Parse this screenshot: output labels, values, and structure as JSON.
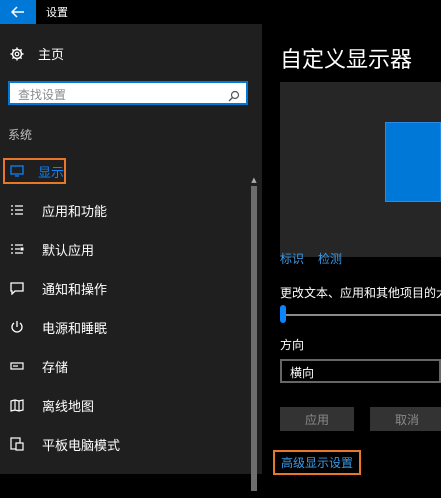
{
  "window": {
    "title": "设置"
  },
  "sidebar": {
    "home_label": "主页",
    "search_placeholder": "查找设置",
    "section_label": "系统",
    "items": [
      {
        "label": "显示",
        "icon": "monitor-icon",
        "active": true
      },
      {
        "label": "应用和功能",
        "icon": "list-icon"
      },
      {
        "label": "默认应用",
        "icon": "default-apps-icon"
      },
      {
        "label": "通知和操作",
        "icon": "notification-icon"
      },
      {
        "label": "电源和睡眠",
        "icon": "power-icon"
      },
      {
        "label": "存储",
        "icon": "storage-icon"
      },
      {
        "label": "离线地图",
        "icon": "map-icon"
      },
      {
        "label": "平板电脑模式",
        "icon": "tablet-mode-icon"
      }
    ]
  },
  "main": {
    "title": "自定义显示器",
    "identify_link": "标识",
    "detect_link": "检测",
    "scale_label": "更改文本、应用和其他项目的大小",
    "orientation_label": "方向",
    "orientation_value": "横向",
    "apply_button": "应用",
    "cancel_button": "取消",
    "advanced_link": "高级显示设置"
  },
  "colors": {
    "accent": "#0078d7",
    "highlight": "#e8772a"
  }
}
